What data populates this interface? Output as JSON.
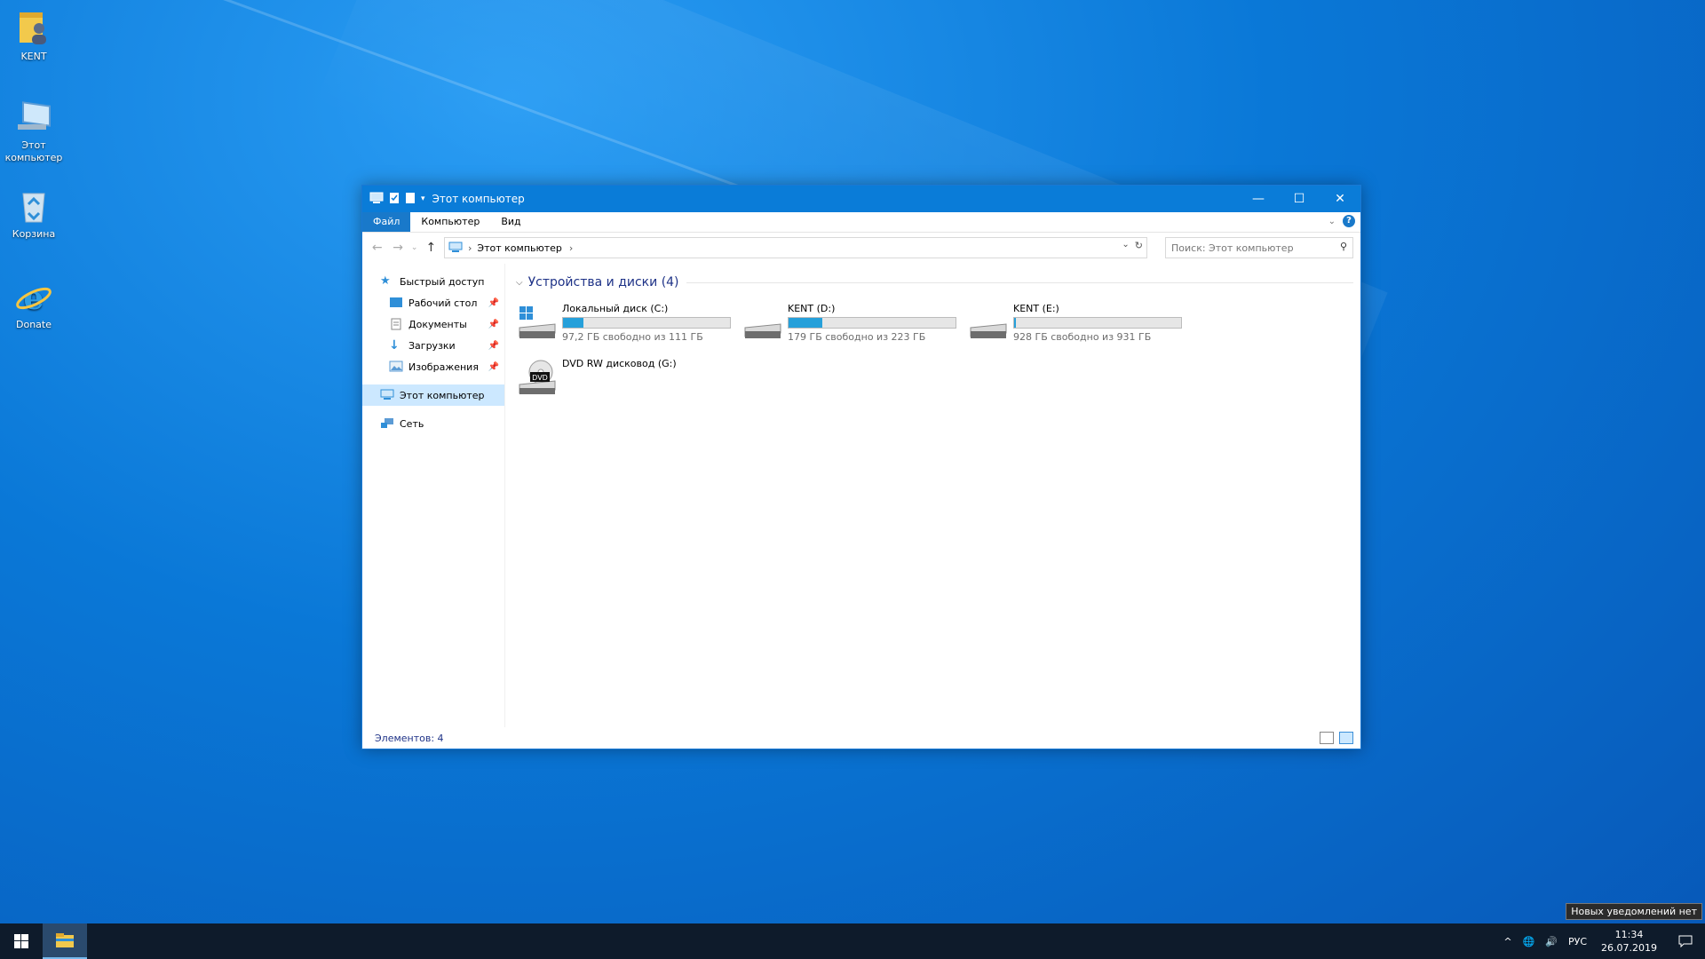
{
  "desktop": {
    "icons": [
      {
        "label": "KENT",
        "icon": "user-folder-icon"
      },
      {
        "label": "Этот компьютер",
        "icon": "computer-icon"
      },
      {
        "label": "Корзина",
        "icon": "recycle-bin-icon"
      },
      {
        "label": "Donate",
        "icon": "internet-explorer-icon"
      }
    ]
  },
  "window": {
    "title": "Этот компьютер",
    "ribbon_tabs": [
      "Файл",
      "Компьютер",
      "Вид"
    ],
    "help": "?",
    "address": {
      "crumb": "Этот компьютер"
    },
    "search": {
      "placeholder": "Поиск: Этот компьютер"
    },
    "nav": {
      "quick_access": "Быстрый доступ",
      "items": [
        "Рабочий стол",
        "Документы",
        "Загрузки",
        "Изображения"
      ],
      "this_pc": "Этот компьютер",
      "network": "Сеть"
    },
    "group_title": "Устройства и диски (4)",
    "drives": [
      {
        "name": "Локальный диск (C:)",
        "free": "97,2 ГБ свободно из 111 ГБ",
        "used_fraction": 0.12
      },
      {
        "name": "KENT (D:)",
        "free": "179 ГБ свободно из 223 ГБ",
        "used_fraction": 0.2
      },
      {
        "name": "KENT (E:)",
        "free": "928 ГБ свободно из 931 ГБ",
        "used_fraction": 0.01
      },
      {
        "name": "DVD RW дисковод (G:)",
        "badge": "DVD"
      }
    ],
    "status": "Элементов: 4"
  },
  "taskbar": {
    "lang": "РУС",
    "time": "11:34",
    "date": "26.07.2019",
    "tooltip": "Новых уведомлений нет"
  }
}
